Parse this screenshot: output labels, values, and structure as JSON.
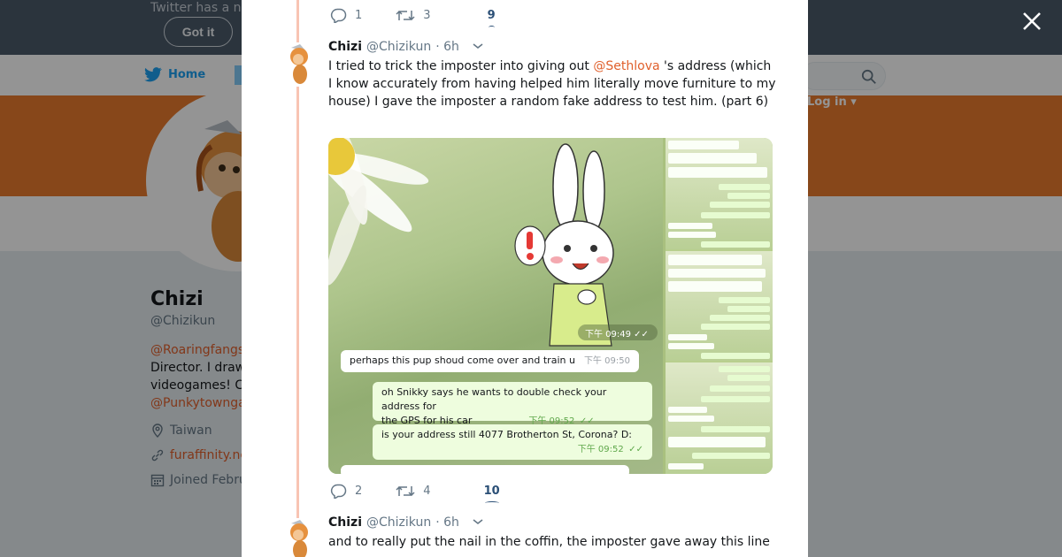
{
  "background": {
    "banner_text": "Twitter has a n",
    "got_it_label": "Got it",
    "nav": {
      "home_label": "Home",
      "login_label": "Log in"
    },
    "profile": {
      "name": "Chizi",
      "handle": "@Chizikun",
      "bio_link_1": "@Roaringfangs",
      "bio_line_1": "Director. I draw",
      "bio_line_2": "videogames! C",
      "bio_link_2": "@Punkytowngа",
      "location": "Taiwan",
      "website": "furaffinity.ne",
      "joined": "Joined Febru"
    }
  },
  "modal": {
    "prev_tweet_actions": {
      "replies": "1",
      "retweets": "3",
      "likes": "9"
    },
    "tweets": [
      {
        "name": "Chizi",
        "handle": "@Chizikun",
        "time": "· 6h",
        "text_before": "I tried to trick the imposter into giving out ",
        "mention": "@Sethlova",
        "text_after": " 's address (which I know accurately from having helped him literally move furniture to my house) I gave the imposter a random fake address to test him. (part 6)",
        "media": {
          "stamp": "下午 09:49",
          "bubbles": [
            {
              "text": "perhaps this pup shoud come over and train u",
              "time": "下午 09:50"
            },
            {
              "text": "oh Snikky says he wants to double check your address for",
              "text2": "the GPS for his car",
              "time": "下午 09:52"
            },
            {
              "text": "is your address still 4077 Brotherton St, Corona? D:",
              "time": "下午 09:52"
            }
          ]
        },
        "actions": {
          "replies": "2",
          "retweets": "4",
          "likes": "10"
        }
      },
      {
        "name": "Chizi",
        "handle": "@Chizikun",
        "time": "· 6h",
        "text": "and to really put the nail in the coffin, the imposter gave away this line"
      }
    ]
  },
  "colors": {
    "accent": "#e0602c",
    "link_blue": "#1da1f2",
    "cover": "#e87a2e",
    "thread_line": "#f8c4b3"
  },
  "icons": [
    "close-icon",
    "reply-icon",
    "retweet-icon",
    "heart-icon",
    "chevron-down-icon",
    "twitter-bird-icon",
    "search-icon",
    "location-icon",
    "link-icon",
    "calendar-icon"
  ]
}
